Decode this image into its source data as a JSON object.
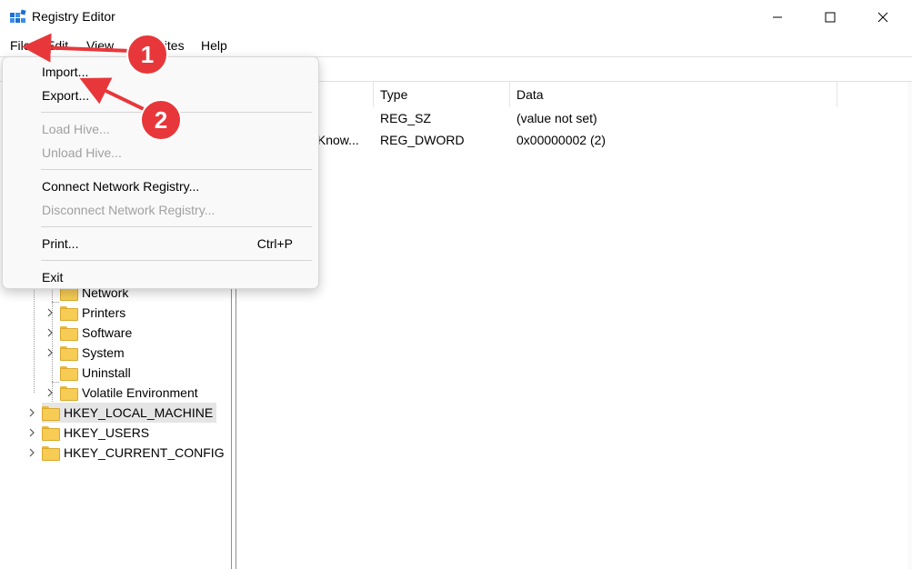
{
  "window": {
    "title": "Registry Editor",
    "icon": "registry-icon"
  },
  "menu": [
    {
      "label": "File"
    },
    {
      "label": "Edit"
    },
    {
      "label": "View"
    },
    {
      "label": "Favorites"
    },
    {
      "label": "Help"
    }
  ],
  "file_menu": {
    "items": [
      {
        "label": "Import...",
        "enabled": true
      },
      {
        "label": "Export...",
        "enabled": true
      },
      {
        "label": "Load Hive...",
        "enabled": false
      },
      {
        "label": "Unload Hive...",
        "enabled": false
      },
      {
        "label": "Connect Network Registry...",
        "enabled": true
      },
      {
        "label": "Disconnect Network Registry...",
        "enabled": false
      },
      {
        "label": "Print...",
        "enabled": true,
        "shortcut": "Ctrl+P"
      },
      {
        "label": "Exit",
        "enabled": true
      }
    ]
  },
  "tree": {
    "children": [
      {
        "label": "Network",
        "expandable": false
      },
      {
        "label": "Printers",
        "expandable": true
      },
      {
        "label": "Software",
        "expandable": true
      },
      {
        "label": "System",
        "expandable": true
      },
      {
        "label": "Uninstall",
        "expandable": false
      },
      {
        "label": "Volatile Environment",
        "expandable": true
      }
    ],
    "roots": [
      {
        "label": "HKEY_LOCAL_MACHINE",
        "selected": true
      },
      {
        "label": "HKEY_USERS",
        "selected": false
      },
      {
        "label": "HKEY_CURRENT_CONFIG",
        "selected": false
      }
    ]
  },
  "values_list": {
    "columns": [
      "Type",
      "Data"
    ],
    "rows": [
      {
        "name": "",
        "type": "REG_SZ",
        "data": "(value not set)"
      },
      {
        "name": "stKnow...",
        "type": "REG_DWORD",
        "data": "0x00000002 (2)"
      }
    ]
  },
  "annotations": [
    {
      "number": "1",
      "color": "#e8373a"
    },
    {
      "number": "2",
      "color": "#e8373a"
    }
  ]
}
